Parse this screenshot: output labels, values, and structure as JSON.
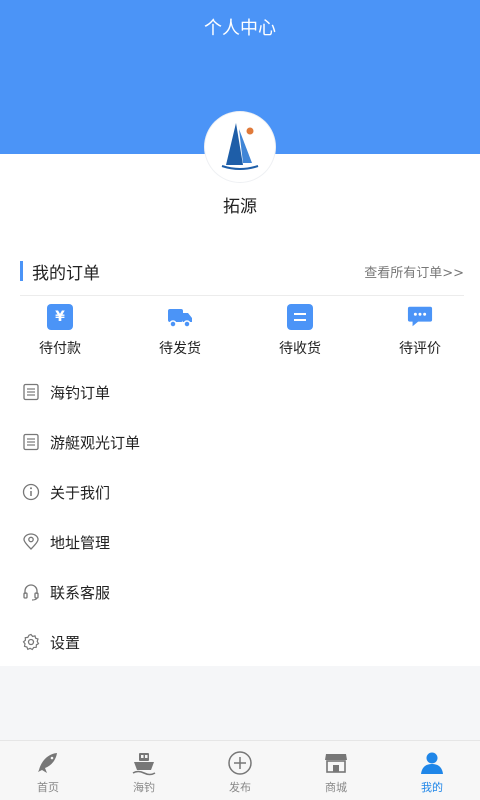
{
  "header": {
    "title": "个人中心"
  },
  "profile": {
    "name": "拓源"
  },
  "orders": {
    "title": "我的订单",
    "view_all": "查看所有订单>>",
    "statuses": [
      {
        "label": "待付款",
        "icon": "yen-icon"
      },
      {
        "label": "待发货",
        "icon": "truck-icon"
      },
      {
        "label": "待收货",
        "icon": "receive-icon"
      },
      {
        "label": "待评价",
        "icon": "comment-icon"
      }
    ]
  },
  "menu": {
    "items": [
      {
        "label": "海钓订单",
        "icon": "list-icon"
      },
      {
        "label": "游艇观光订单",
        "icon": "list-icon"
      },
      {
        "label": "关于我们",
        "icon": "info-icon"
      },
      {
        "label": "地址管理",
        "icon": "location-icon"
      },
      {
        "label": "联系客服",
        "icon": "headset-icon"
      },
      {
        "label": "设置",
        "icon": "gear-icon"
      }
    ]
  },
  "tabbar": {
    "tabs": [
      {
        "label": "首页",
        "icon": "fish-icon"
      },
      {
        "label": "海钓",
        "icon": "boat-icon"
      },
      {
        "label": "发布",
        "icon": "plus-circle-icon"
      },
      {
        "label": "商城",
        "icon": "shop-icon"
      },
      {
        "label": "我的",
        "icon": "user-icon"
      }
    ],
    "active_index": 4
  },
  "colors": {
    "accent": "#4b94f7",
    "tab_active": "#1f86e8"
  }
}
